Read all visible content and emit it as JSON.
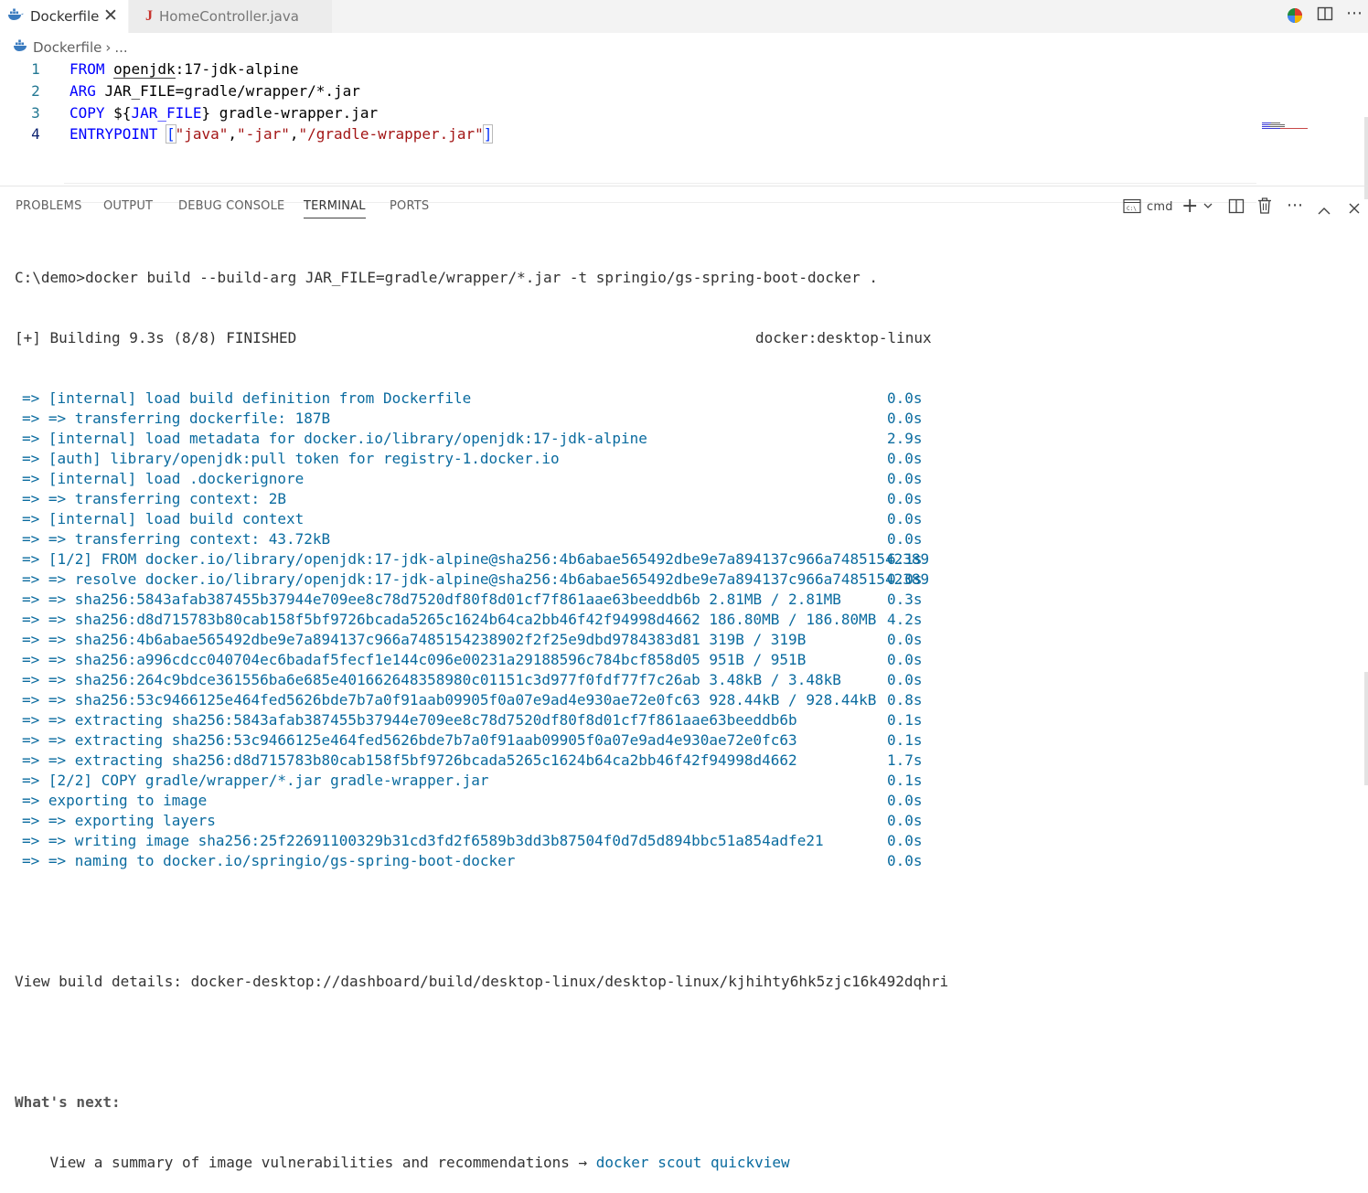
{
  "tabs": [
    {
      "label": "Dockerfile",
      "icon": "docker-whale-icon",
      "active": true
    },
    {
      "label": "HomeController.java",
      "icon": "java-icon",
      "active": false
    }
  ],
  "breadcrumb": {
    "file": "Dockerfile",
    "sep": "›",
    "more": "..."
  },
  "editor": {
    "lines": [
      {
        "n": "1",
        "kw": "FROM",
        "a": "openjdk",
        "b": ":17-jdk-alpine"
      },
      {
        "n": "2",
        "kw": "ARG",
        "a": "JAR_FILE=gradle/wrapper/*.jar"
      },
      {
        "n": "3",
        "kw": "COPY",
        "a": "${",
        "b": "JAR_FILE",
        "c": "}",
        "d": " gradle-wrapper.jar"
      },
      {
        "n": "4",
        "kw": "ENTRYPOINT",
        "o": "[",
        "s1": "\"java\"",
        "c1": ",",
        "s2": "\"-jar\"",
        "c2": ",",
        "s3": "\"/gradle-wrapper.jar\"",
        "cl": "]"
      }
    ]
  },
  "panel": {
    "tabs": [
      "PROBLEMS",
      "OUTPUT",
      "DEBUG CONSOLE",
      "TERMINAL",
      "PORTS"
    ],
    "active": "TERMINAL",
    "shell": "cmd"
  },
  "terminal": {
    "command": "C:\\demo>docker build --build-arg JAR_FILE=gradle/wrapper/*.jar -t springio/gs-spring-boot-docker .",
    "status": "[+] Building 9.3s (8/8) FINISHED",
    "context": "docker:desktop-linux",
    "steps": [
      {
        "text": "=> [internal] load build definition from Dockerfile",
        "time": "0.0s"
      },
      {
        "text": "=> => transferring dockerfile: 187B",
        "time": "0.0s"
      },
      {
        "text": "=> [internal] load metadata for docker.io/library/openjdk:17-jdk-alpine",
        "time": "2.9s"
      },
      {
        "text": "=> [auth] library/openjdk:pull token for registry-1.docker.io",
        "time": "0.0s"
      },
      {
        "text": "=> [internal] load .dockerignore",
        "time": "0.0s"
      },
      {
        "text": "=> => transferring context: 2B",
        "time": "0.0s"
      },
      {
        "text": "=> [internal] load build context",
        "time": "0.0s"
      },
      {
        "text": "=> => transferring context: 43.72kB",
        "time": "0.0s"
      },
      {
        "text": "=> [1/2] FROM docker.io/library/openjdk:17-jdk-alpine@sha256:4b6abae565492dbe9e7a894137c966a74851542389",
        "time": "6.1s"
      },
      {
        "text": "=> => resolve docker.io/library/openjdk:17-jdk-alpine@sha256:4b6abae565492dbe9e7a894137c966a74851542389",
        "time": "0.0s"
      },
      {
        "text": "=> => sha256:5843afab387455b37944e709ee8c78d7520df80f8d01cf7f861aae63beeddb6b 2.81MB / 2.81MB",
        "time": "0.3s"
      },
      {
        "text": "=> => sha256:d8d715783b80cab158f5bf9726bcada5265c1624b64ca2bb46f42f94998d4662 186.80MB / 186.80MB",
        "time": "4.2s"
      },
      {
        "text": "=> => sha256:4b6abae565492dbe9e7a894137c966a7485154238902f2f25e9dbd9784383d81 319B / 319B",
        "time": "0.0s"
      },
      {
        "text": "=> => sha256:a996cdcc040704ec6badaf5fecf1e144c096e00231a29188596c784bcf858d05 951B / 951B",
        "time": "0.0s"
      },
      {
        "text": "=> => sha256:264c9bdce361556ba6e685e401662648358980c01151c3d977f0fdf77f7c26ab 3.48kB / 3.48kB",
        "time": "0.0s"
      },
      {
        "text": "=> => sha256:53c9466125e464fed5626bde7b7a0f91aab09905f0a07e9ad4e930ae72e0fc63 928.44kB / 928.44kB",
        "time": "0.8s"
      },
      {
        "text": "=> => extracting sha256:5843afab387455b37944e709ee8c78d7520df80f8d01cf7f861aae63beeddb6b",
        "time": "0.1s"
      },
      {
        "text": "=> => extracting sha256:53c9466125e464fed5626bde7b7a0f91aab09905f0a07e9ad4e930ae72e0fc63",
        "time": "0.1s"
      },
      {
        "text": "=> => extracting sha256:d8d715783b80cab158f5bf9726bcada5265c1624b64ca2bb46f42f94998d4662",
        "time": "1.7s"
      },
      {
        "text": "=> [2/2] COPY gradle/wrapper/*.jar gradle-wrapper.jar",
        "time": "0.1s"
      },
      {
        "text": "=> exporting to image",
        "time": "0.0s"
      },
      {
        "text": "=> => exporting layers",
        "time": "0.0s"
      },
      {
        "text": "=> => writing image sha256:25f22691100329b31cd3fd2f6589b3dd3b87504f0d7d5d894bbc51a854adfe21",
        "time": "0.0s"
      },
      {
        "text": "=> => naming to docker.io/springio/gs-spring-boot-docker",
        "time": "0.0s"
      }
    ],
    "details": "View build details: docker-desktop://dashboard/build/desktop-linux/desktop-linux/kjhihty6hk5zjc16k492dqhri",
    "next_title": "What's next:",
    "next_text": "    View a summary of image vulnerabilities and recommendations → ",
    "next_cmd": "docker scout quickview"
  }
}
